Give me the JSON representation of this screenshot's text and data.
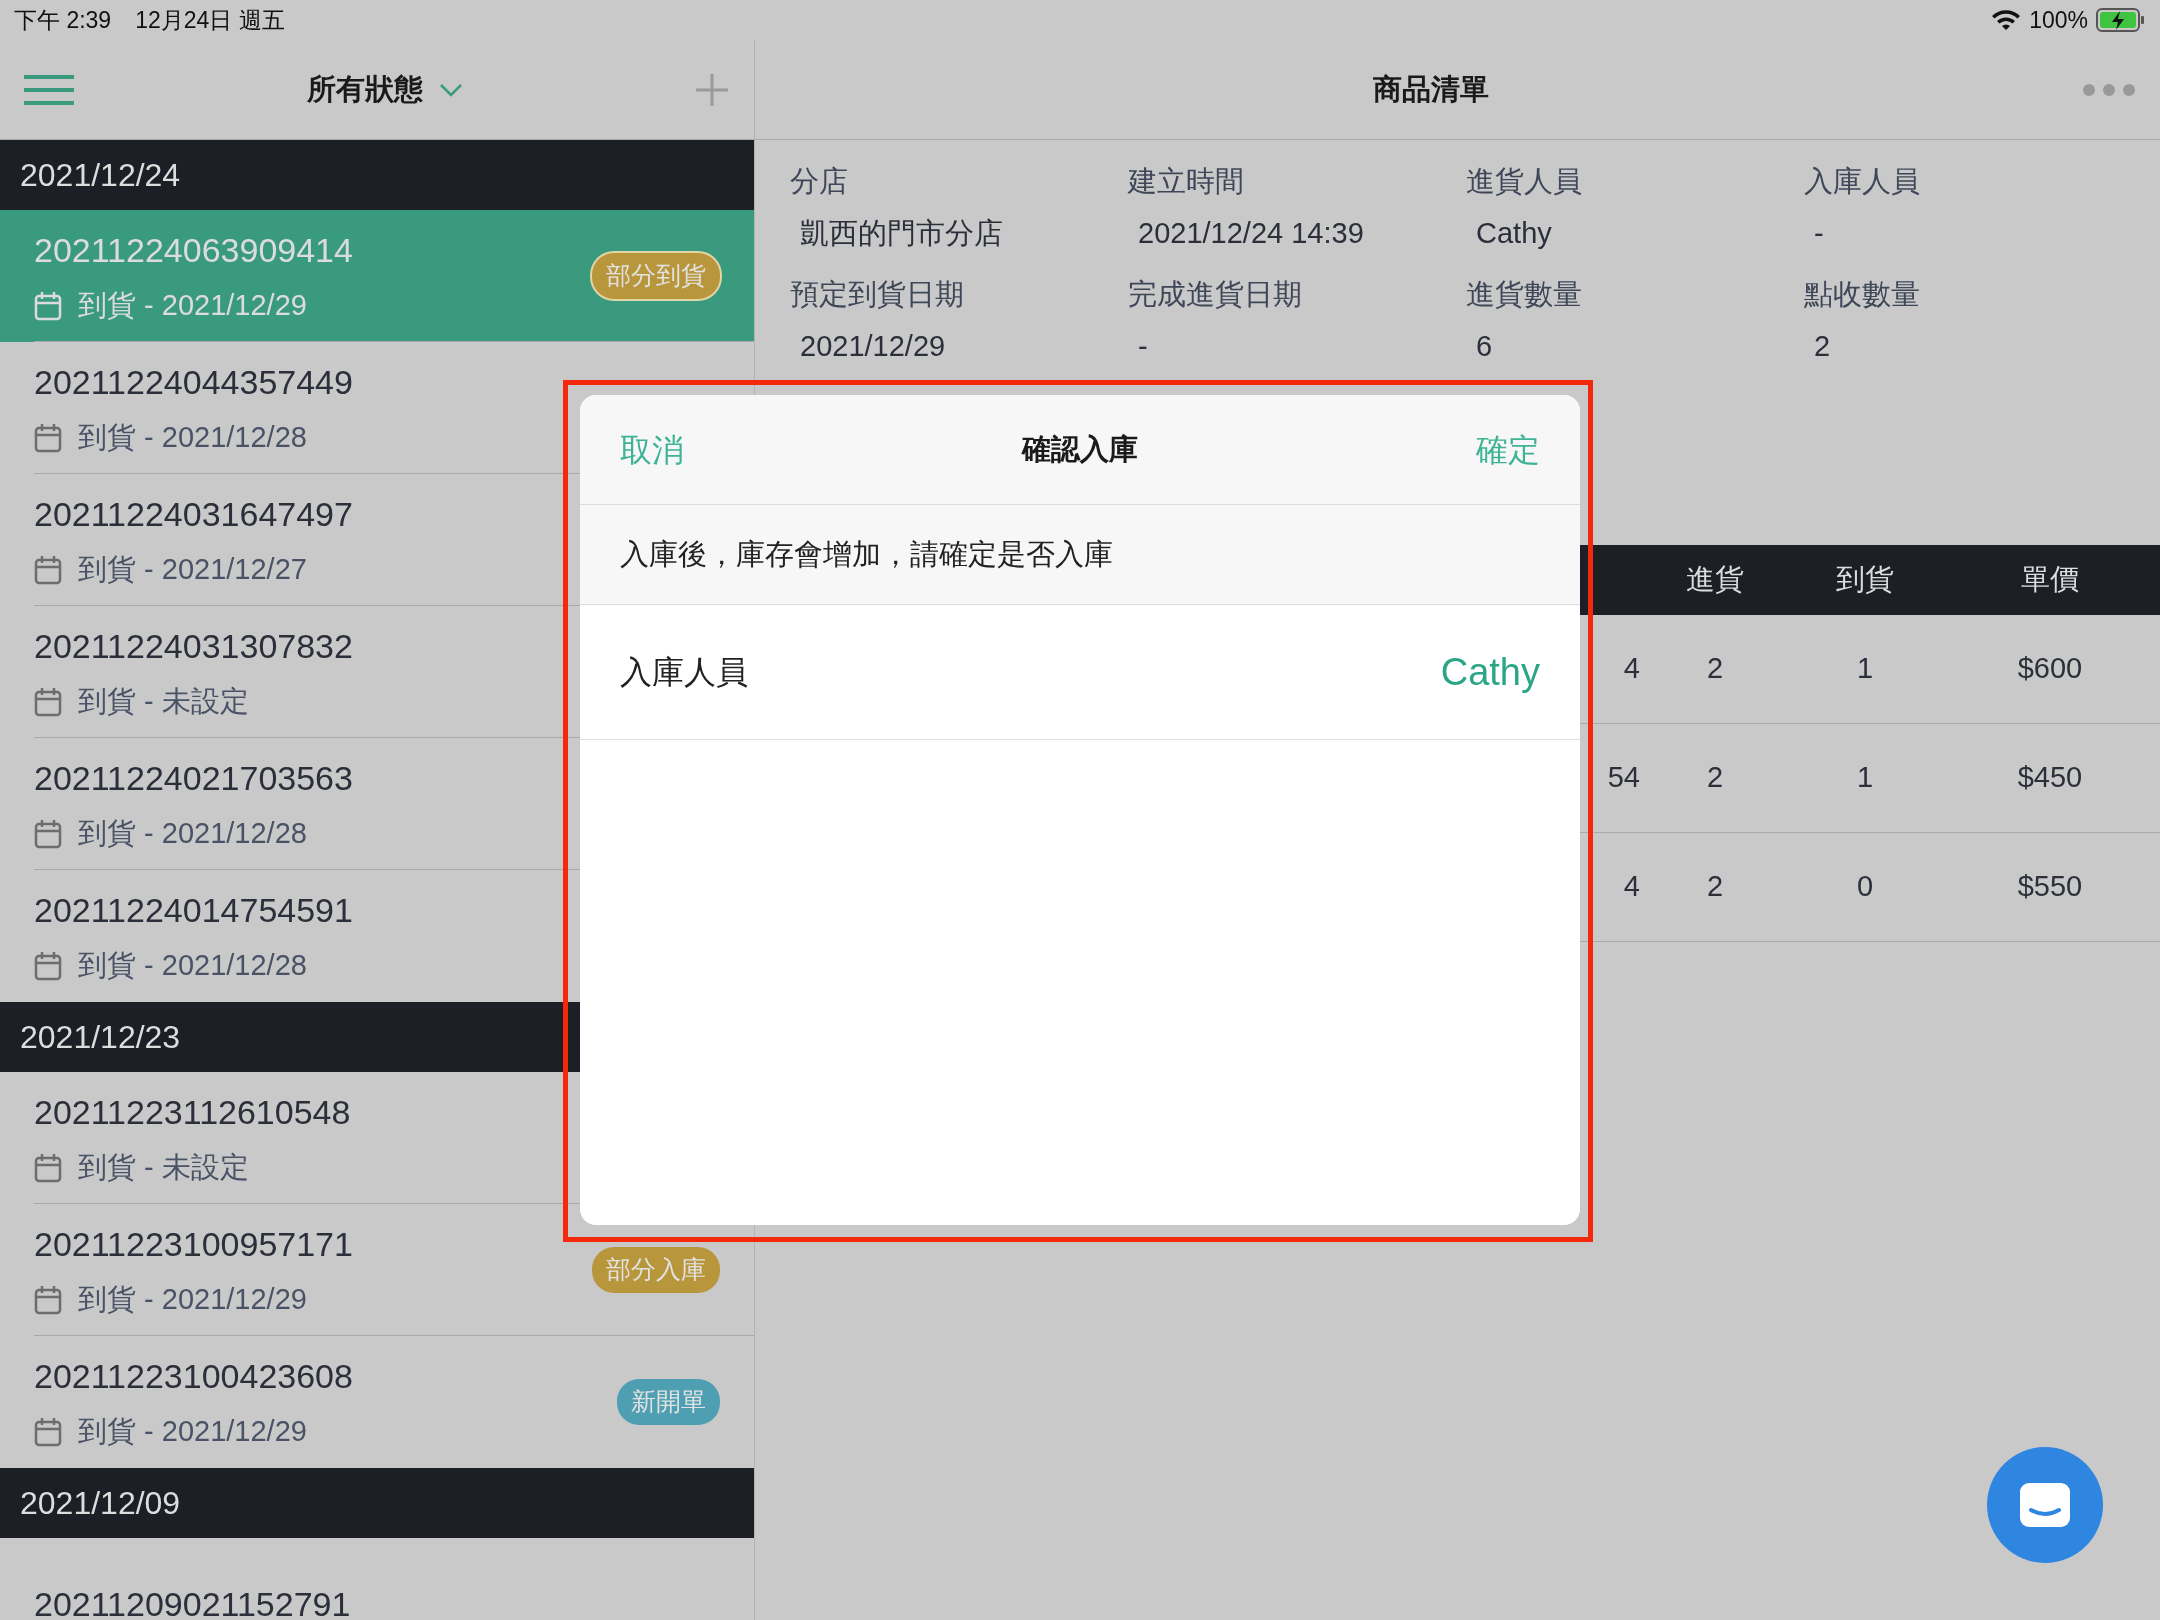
{
  "status_bar": {
    "time": "下午 2:39",
    "date": "12月24日 週五",
    "battery": "100%"
  },
  "left_nav": {
    "title": "所有狀態"
  },
  "sections": [
    {
      "date": "2021/12/24",
      "orders": [
        {
          "number": "20211224063909414",
          "arrival": "到貨 - 2021/12/29",
          "selected": true,
          "badge": {
            "label": "部分到貨",
            "color": "#b8963c"
          }
        },
        {
          "number": "20211224044357449",
          "arrival": "到貨 - 2021/12/28",
          "selected": false
        },
        {
          "number": "20211224031647497",
          "arrival": "到貨 - 2021/12/27",
          "selected": false
        },
        {
          "number": "20211224031307832",
          "arrival": "到貨 - 未設定",
          "selected": false
        },
        {
          "number": "20211224021703563",
          "arrival": "到貨 - 2021/12/28",
          "selected": false
        },
        {
          "number": "20211224014754591",
          "arrival": "到貨 - 2021/12/28",
          "selected": false
        }
      ]
    },
    {
      "date": "2021/12/23",
      "orders": [
        {
          "number": "20211223112610548",
          "arrival": "到貨 - 未設定",
          "selected": false
        },
        {
          "number": "20211223100957171",
          "arrival": "到貨 - 2021/12/29",
          "selected": false,
          "badge": {
            "label": "部分入庫",
            "color": "#b8963c"
          }
        },
        {
          "number": "20211223100423608",
          "arrival": "到貨 - 2021/12/29",
          "selected": false,
          "badge": {
            "label": "新開單",
            "color": "#4f9fb2"
          }
        }
      ]
    },
    {
      "date": "2021/12/09",
      "orders": [
        {
          "number": "20211209021152791",
          "selected": false
        }
      ]
    }
  ],
  "right_nav": {
    "title": "商品清單"
  },
  "details": [
    {
      "label": "分店",
      "value": "凱西的門市分店"
    },
    {
      "label": "建立時間",
      "value": "2021/12/24 14:39"
    },
    {
      "label": "進貨人員",
      "value": "Cathy"
    },
    {
      "label": "入庫人員",
      "value": "-"
    },
    {
      "label": "預定到貨日期",
      "value": "2021/12/29"
    },
    {
      "label": "完成進貨日期",
      "value": "-"
    },
    {
      "label": "進貨數量",
      "value": "6"
    },
    {
      "label": "點收數量",
      "value": "2"
    }
  ],
  "table": {
    "columns": [
      "進貨",
      "到貨",
      "單價"
    ],
    "rows": [
      {
        "column_1": "4",
        "cells": [
          "2",
          "1",
          "$600"
        ]
      },
      {
        "column_1": "54",
        "cells": [
          "2",
          "1",
          "$450"
        ]
      },
      {
        "column_1": "4",
        "cells": [
          "2",
          "0",
          "$550"
        ]
      }
    ]
  },
  "dialog": {
    "cancel": "取消",
    "title": "確認入庫",
    "confirm": "確定",
    "message": "入庫後，庫存會增加，請確定是否入庫",
    "field_label": "入庫人員",
    "field_value": "Cathy"
  }
}
